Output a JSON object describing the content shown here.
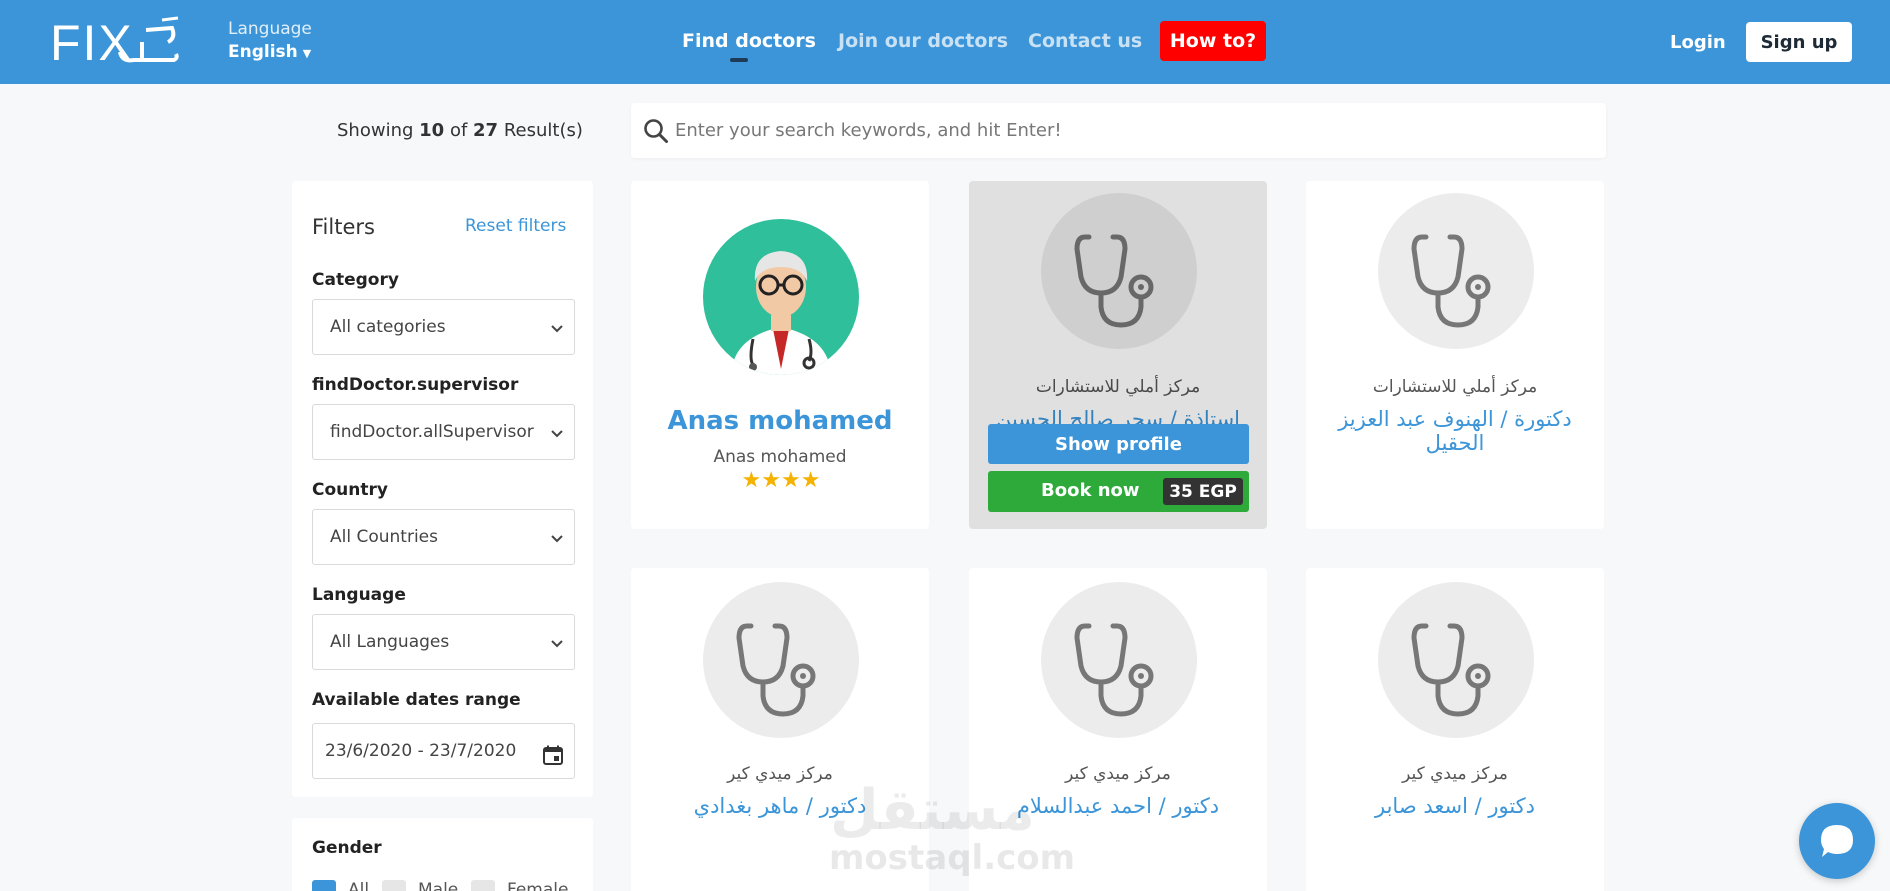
{
  "header": {
    "logo_text": "FIX حَل",
    "language_caption": "Language",
    "language_value": "English",
    "nav": [
      {
        "label": "Find doctors",
        "active": true
      },
      {
        "label": "Join our doctors",
        "active": false
      },
      {
        "label": "Contact us",
        "active": false
      }
    ],
    "howto_label": "How to?",
    "login_label": "Login",
    "signup_label": "Sign up",
    "colors": {
      "brand": "#3b95d8",
      "howto": "#ff0000"
    }
  },
  "results": {
    "prefix": "Showing",
    "shown": "10",
    "of_label": "of",
    "total": "27",
    "suffix": "Result(s)"
  },
  "search": {
    "placeholder": "Enter your search keywords, and hit Enter!"
  },
  "filters": {
    "title": "Filters",
    "reset_label": "Reset filters",
    "category": {
      "label": "Category",
      "value": "All categories"
    },
    "supervisor": {
      "label": "findDoctor.supervisor",
      "value": "findDoctor.allSupervisor"
    },
    "country": {
      "label": "Country",
      "value": "All Countries"
    },
    "language": {
      "label": "Language",
      "value": "All Languages"
    },
    "dates": {
      "label": "Available dates range",
      "value": "23/6/2020 - 23/7/2020"
    },
    "gender": {
      "label": "Gender",
      "options": [
        "All",
        "Male",
        "Female"
      ],
      "selected": "All"
    }
  },
  "cards": [
    {
      "name": "Anas mohamed",
      "subtitle": "Anas mohamed",
      "rating": 4,
      "avatar": "doctor-illustration"
    },
    {
      "center": "مركز أملي للاستشارات",
      "name": "استاذة / سحر صالح الحسين",
      "avatar": "stethoscope-icon",
      "show_profile": "Show profile",
      "book_now": "Book now",
      "price": "35 EGP"
    },
    {
      "center": "مركز أملي للاستشارات",
      "name": "دكتورة / الهنوف عبد العزيز الحقيل",
      "avatar": "stethoscope-icon"
    },
    {
      "center": "مركز ميدي كير",
      "name": "دكتور / ماهر بغدادي",
      "avatar": "stethoscope-icon"
    },
    {
      "center": "مركز ميدي كير",
      "name": "دكتور / احمد عبدالسلام",
      "avatar": "stethoscope-icon"
    },
    {
      "center": "مركز ميدي كير",
      "name": "دكتور / اسعد صابر",
      "avatar": "stethoscope-icon"
    }
  ],
  "watermark": {
    "arabic": "مستقل",
    "latin": "mostaql.com"
  }
}
